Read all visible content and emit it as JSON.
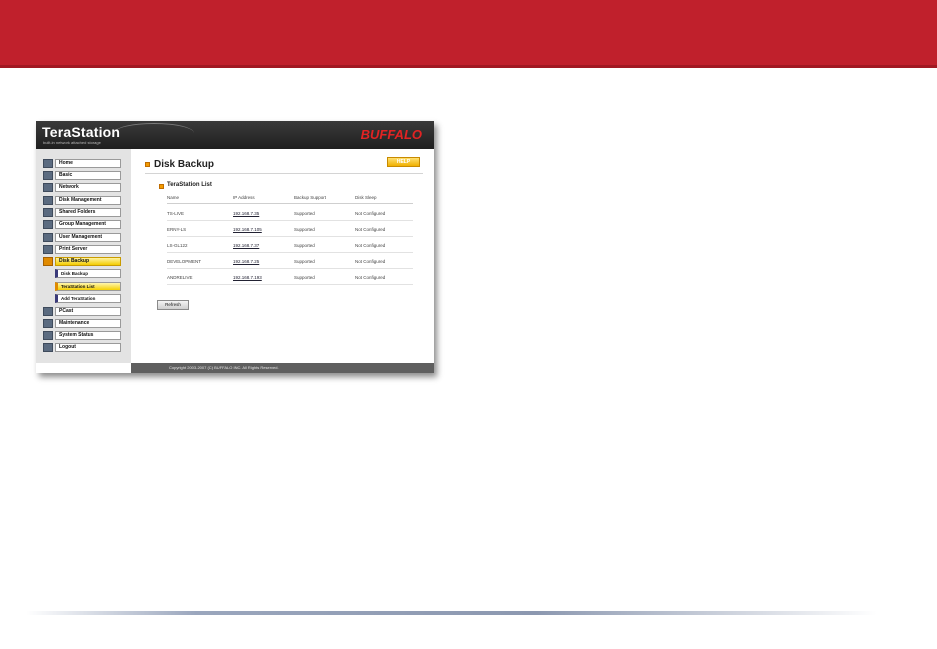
{
  "app": {
    "brand": "TeraStation",
    "brand_subtitle": "built-in network attached storage",
    "logo": "BUFFALO"
  },
  "sidebar": {
    "items": [
      {
        "label": "Home",
        "icon": "home-icon"
      },
      {
        "label": "Basic",
        "icon": "basic-icon"
      },
      {
        "label": "Network",
        "icon": "network-icon"
      },
      {
        "label": "Disk Management",
        "icon": "disk-icon"
      },
      {
        "label": "Shared Folders",
        "icon": "folder-icon"
      },
      {
        "label": "Group Management",
        "icon": "group-icon"
      },
      {
        "label": "User Management",
        "icon": "user-icon"
      },
      {
        "label": "Print Server",
        "icon": "printer-icon"
      },
      {
        "label": "Disk Backup",
        "icon": "backup-icon",
        "active": true
      },
      {
        "label": "PCast",
        "icon": "pcast-icon"
      },
      {
        "label": "Maintenance",
        "icon": "maintenance-icon"
      },
      {
        "label": "System Status",
        "icon": "status-icon"
      },
      {
        "label": "Logout",
        "icon": "logout-icon"
      }
    ],
    "subitems": [
      {
        "label": "Disk Backup"
      },
      {
        "label": "TeraStation List",
        "current": true
      },
      {
        "label": "Add TeraStation"
      }
    ]
  },
  "main": {
    "title": "Disk Backup",
    "help_label": "HELP",
    "section_title": "TeraStation List",
    "columns": [
      "Name",
      "IP Address",
      "Backup Support",
      "Disk Sleep"
    ],
    "rows": [
      {
        "name": "TS-LIVE",
        "ip": "192.168.7.35",
        "backup": "Supported",
        "sleep": "Not Configured"
      },
      {
        "name": "ERNY-LS",
        "ip": "192.168.7.105",
        "backup": "Supported",
        "sleep": "Not Configured"
      },
      {
        "name": "LS-GL122",
        "ip": "192.168.7.37",
        "backup": "Supported",
        "sleep": "Not Configured"
      },
      {
        "name": "DEVELOPMENT",
        "ip": "192.168.7.25",
        "backup": "Supported",
        "sleep": "Not Configured"
      },
      {
        "name": "ANDRELIVE",
        "ip": "192.168.7.193",
        "backup": "Supported",
        "sleep": "Not Configured"
      }
    ],
    "refresh_label": "Refresh"
  },
  "footer": {
    "copyright": "Copyright 2003-2007 (C) BUFFALO INC. All Rights Reserved."
  },
  "colors": {
    "banner": "#c0202c",
    "active_nav": "#f3cc00",
    "accent_bullet": "#f39b00"
  }
}
